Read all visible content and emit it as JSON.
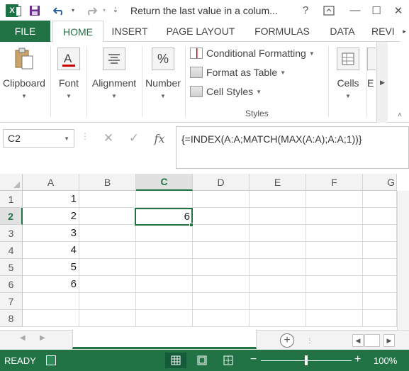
{
  "titlebar": {
    "title": "Return the last value in a colum...",
    "help": "?",
    "restore_ribbon": "⧉",
    "minimize": "—",
    "maximize": "☐",
    "close": "✕"
  },
  "tabs": {
    "file": "FILE",
    "home": "HOME",
    "insert": "INSERT",
    "page_layout": "PAGE LAYOUT",
    "formulas": "FORMULAS",
    "data": "DATA",
    "review": "REVI"
  },
  "ribbon": {
    "clipboard": "Clipboard",
    "font": "Font",
    "alignment": "Alignment",
    "number": "Number",
    "number_icon": "%",
    "conditional_formatting": "Conditional Formatting",
    "format_as_table": "Format as Table",
    "cell_styles": "Cell Styles",
    "styles_group": "Styles",
    "cells": "Cells",
    "editing": "E"
  },
  "formula_bar": {
    "name_box": "C2",
    "fx": "fx",
    "formula": "{=INDEX(A:A;MATCH(MAX(A:A);A:A;1))}"
  },
  "grid": {
    "columns": [
      "A",
      "B",
      "C",
      "D",
      "E",
      "F",
      "G"
    ],
    "rows": [
      "1",
      "2",
      "3",
      "4",
      "5",
      "6",
      "7",
      "8"
    ],
    "selected_column": "C",
    "selected_row": "2",
    "col_a_values": [
      "1",
      "2",
      "3",
      "4",
      "5",
      "6",
      "",
      ""
    ],
    "active_cell_value": "6"
  },
  "status": {
    "ready": "READY",
    "zoom_minus": "−",
    "zoom_plus": "+",
    "zoom": "100%"
  },
  "colors": {
    "accent": "#217346",
    "status_bar": "#217346"
  }
}
